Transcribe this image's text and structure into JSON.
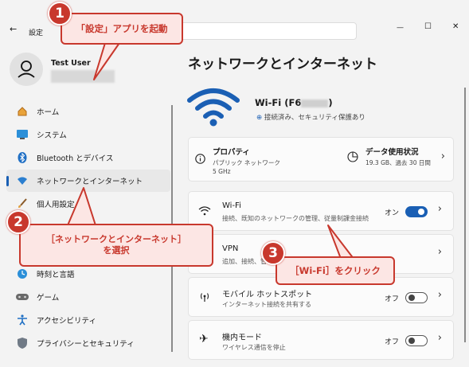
{
  "window": {
    "title": "設定",
    "back_icon": "←",
    "minimize_icon": "—",
    "maximize_icon": "☐",
    "close_icon": "✕"
  },
  "user": {
    "name": "Test User"
  },
  "sidebar": {
    "items": [
      {
        "label": "ホーム",
        "icon": "home-icon"
      },
      {
        "label": "システム",
        "icon": "system-icon"
      },
      {
        "label": "Bluetooth とデバイス",
        "icon": "bluetooth-icon"
      },
      {
        "label": "ネットワークとインターネット",
        "icon": "network-icon",
        "selected": true
      },
      {
        "label": "個人用設定",
        "icon": "brush-icon"
      },
      {
        "label": "時刻と言語",
        "icon": "clock-icon"
      },
      {
        "label": "ゲーム",
        "icon": "gamepad-icon"
      },
      {
        "label": "アクセシビリティ",
        "icon": "accessibility-icon"
      },
      {
        "label": "プライバシーとセキュリティ",
        "icon": "shield-icon"
      }
    ]
  },
  "main": {
    "page_title": "ネットワークとインターネット",
    "wifi_status": {
      "name": "Wi-Fi (F6",
      "name_suffix": ")",
      "status": "接続済み、セキュリティ保護あり"
    },
    "properties": {
      "title": "プロパティ",
      "line1": "パブリック ネットワーク",
      "line2": "5 GHz"
    },
    "data_usage": {
      "title": "データ使用状況",
      "detail": "19.3 GB、過去 30 日間"
    },
    "rows": [
      {
        "title": "Wi-Fi",
        "sub": "接続、既知のネットワークの管理、従量制課金接続",
        "toggle_label": "オン",
        "toggle_on": true
      },
      {
        "title": "VPN",
        "sub": "追加、接続、管理"
      },
      {
        "title": "モバイル ホットスポット",
        "sub": "インターネット接続を共有する",
        "toggle_label": "オフ",
        "toggle_on": false
      },
      {
        "title": "機内モード",
        "sub": "ワイヤレス通信を停止",
        "toggle_label": "オフ",
        "toggle_on": false
      }
    ]
  },
  "annotations": {
    "step1": {
      "number": "1",
      "text": "「設定」アプリを起動"
    },
    "step2": {
      "number": "2",
      "text_line1": "［ネットワークとインターネット］",
      "text_line2": "を選択"
    },
    "step3": {
      "number": "3",
      "text": "［Wi-Fi］をクリック"
    }
  },
  "colors": {
    "accent": "#1a5fb4",
    "callout_red": "#c8382d"
  }
}
